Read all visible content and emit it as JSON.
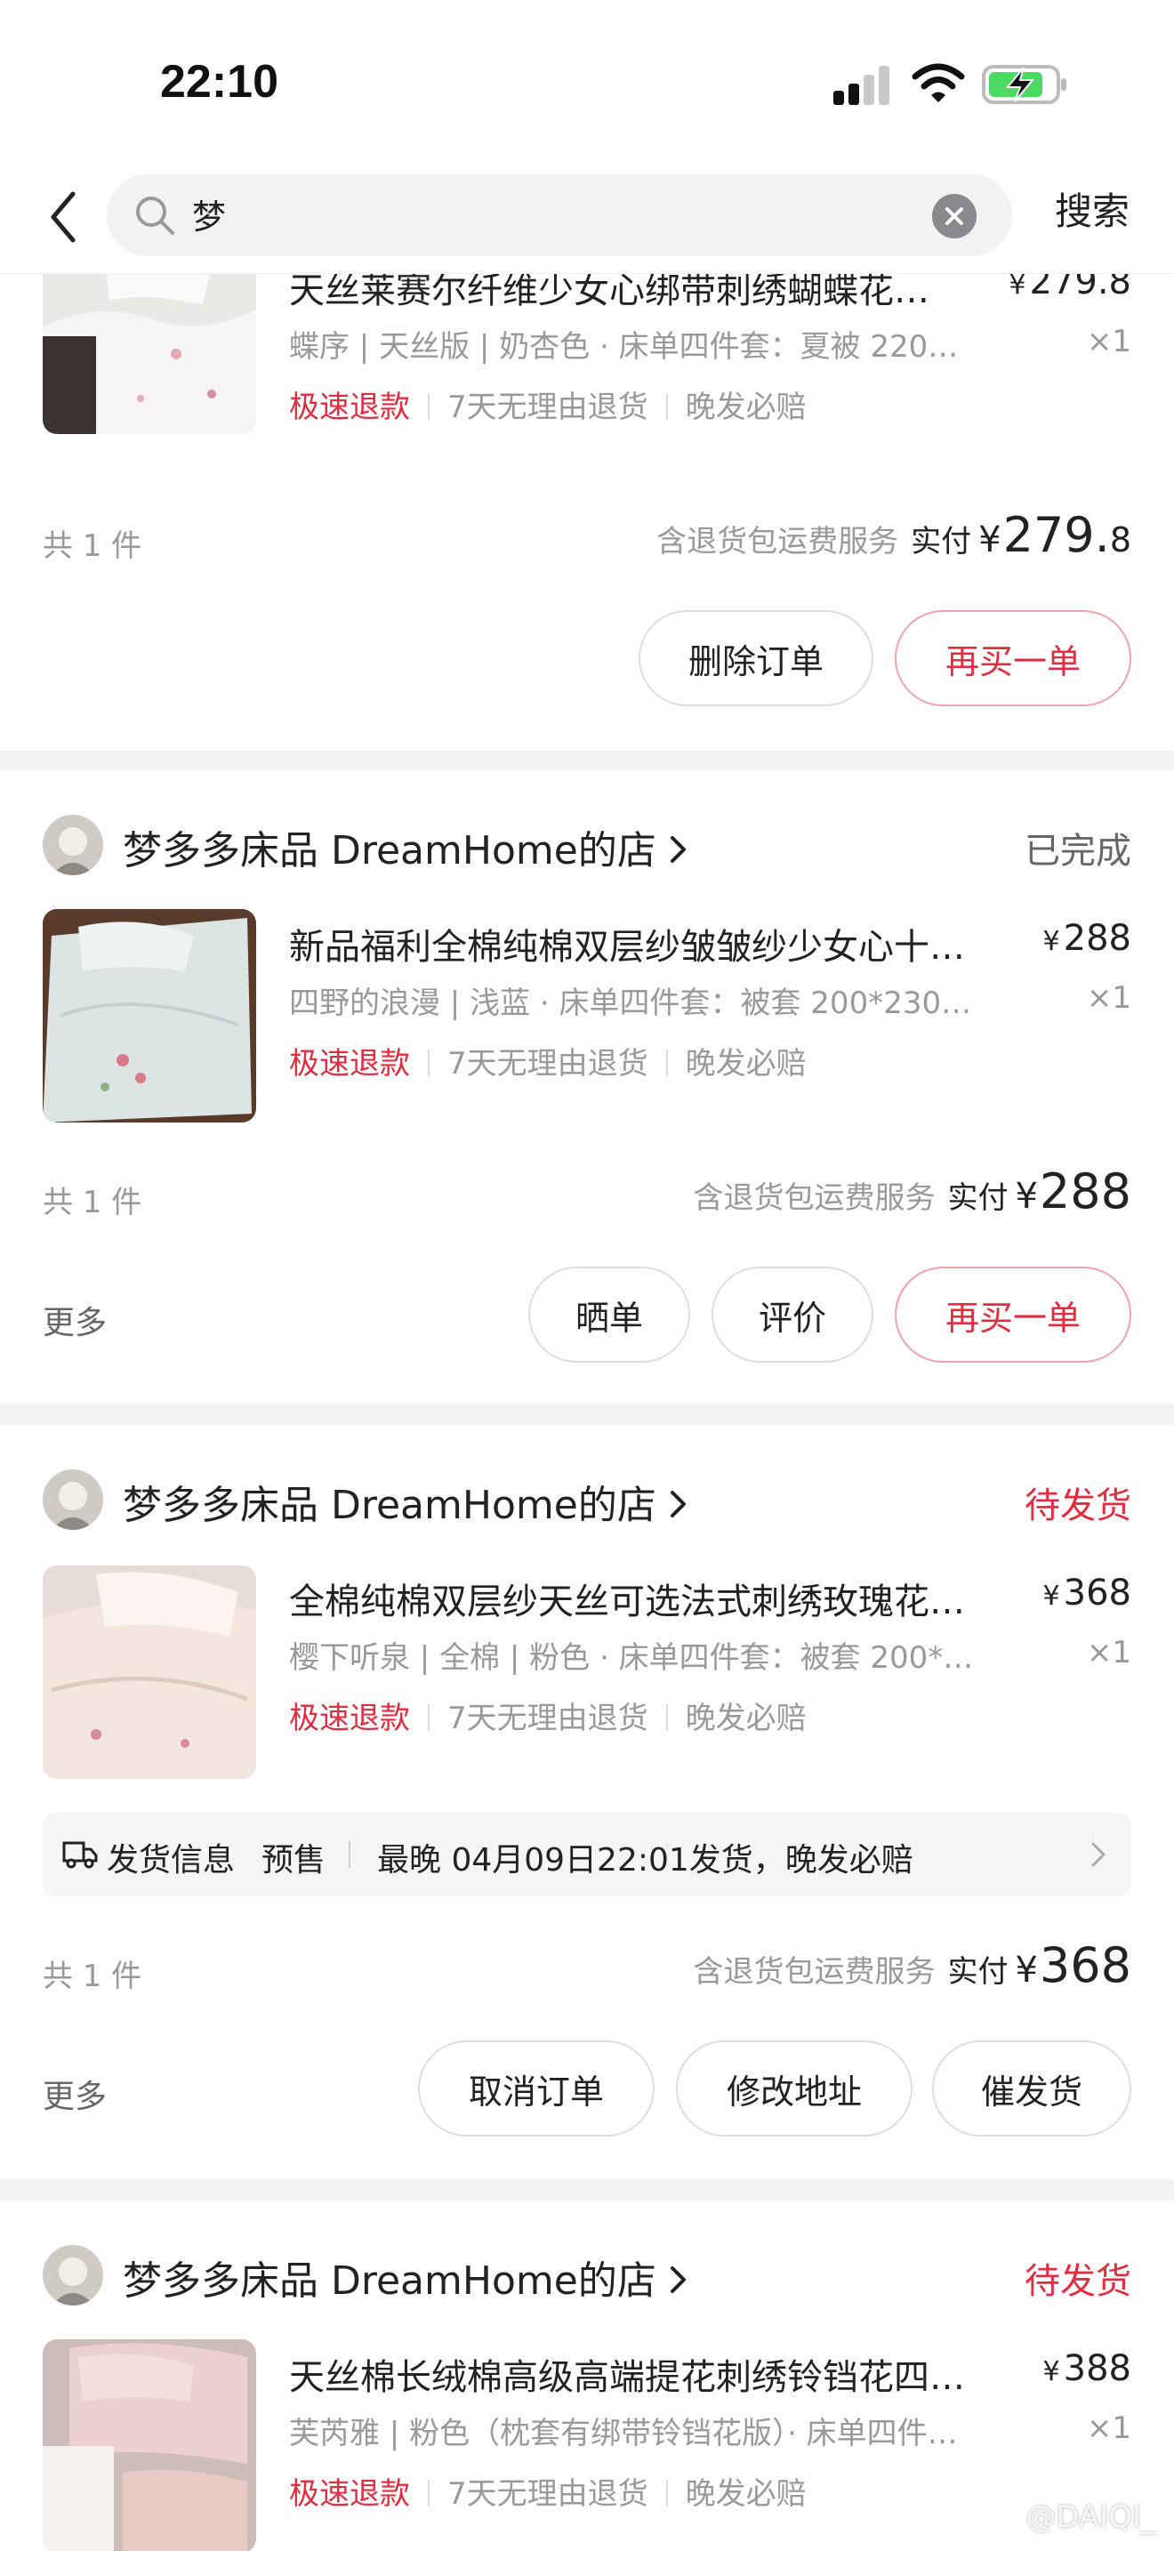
{
  "status_bar": {
    "time": "22:10"
  },
  "header": {
    "search_query": "梦",
    "search_button": "搜索"
  },
  "orders": [
    {
      "product_title": "天丝莱赛尔纤维少女心绑带刺绣蝴蝶花…",
      "price": "279.8",
      "spec": "蝶序 | 天丝版 | 奶杏色 · 床单四件套：夏被 220…",
      "qty": "×1",
      "tags": [
        "极速退款",
        "7天无理由退货",
        "晚发必赔"
      ],
      "count": "共 1 件",
      "pay_note": "含退货包运费服务",
      "pay_label": "实付",
      "pay_yen": "¥",
      "pay_amount": "279.",
      "pay_cents": "8",
      "buttons": [
        "删除订单",
        "再买一单"
      ]
    },
    {
      "shop_name": "梦多多床品 DreamHome的店",
      "status": "已完成",
      "product_title": "新品福利全棉纯棉双层纱皱皱纱少女心十…",
      "price": "288",
      "spec": "四野的浪漫 | 浅蓝 · 床单四件套：被套 200*230…",
      "qty": "×1",
      "tags": [
        "极速退款",
        "7天无理由退货",
        "晚发必赔"
      ],
      "count": "共 1 件",
      "pay_note": "含退货包运费服务",
      "pay_label": "实付",
      "pay_yen": "¥",
      "pay_amount": "288",
      "more": "更多",
      "buttons": [
        "晒单",
        "评价",
        "再买一单"
      ]
    },
    {
      "shop_name": "梦多多床品 DreamHome的店",
      "status": "待发货",
      "product_title": "全棉纯棉双层纱天丝可选法式刺绣玫瑰花…",
      "price": "368",
      "spec": "樱下听泉 | 全棉 | 粉色 · 床单四件套：被套 200*…",
      "qty": "×1",
      "tags": [
        "极速退款",
        "7天无理由退货",
        "晚发必赔"
      ],
      "shipping": {
        "label": "发货信息",
        "presale": "预售",
        "info": "最晚 04月09日22:01发货，晚发必赔"
      },
      "count": "共 1 件",
      "pay_note": "含退货包运费服务",
      "pay_label": "实付",
      "pay_yen": "¥",
      "pay_amount": "368",
      "more": "更多",
      "buttons": [
        "取消订单",
        "修改地址",
        "催发货"
      ]
    },
    {
      "shop_name": "梦多多床品 DreamHome的店",
      "status": "待发货",
      "product_title": "天丝棉长绒棉高级高端提花刺绣铃铛花四…",
      "price": "388",
      "spec": "芙芮雅 | 粉色（枕套有绑带铃铛花版）· 床单四件…",
      "qty": "×1",
      "tags": [
        "极速退款",
        "7天无理由退货",
        "晚发必赔"
      ]
    }
  ],
  "watermark": "@DAIQI_",
  "colors": {
    "accent_red": "#e02e40",
    "bg_gray": "#f4f4f4",
    "battery_green": "#4cd964"
  }
}
